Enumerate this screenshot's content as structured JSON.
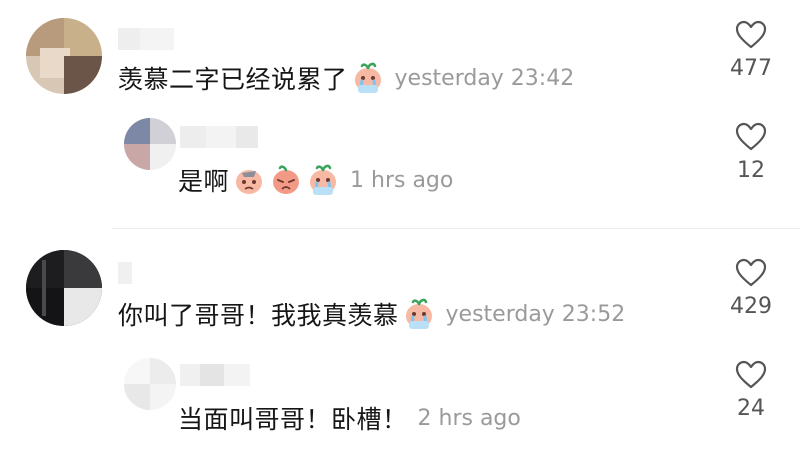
{
  "comments": [
    {
      "text": "羡慕二字已经说累了",
      "emoji": [
        "crying-face-icon"
      ],
      "time": "yesterday 23:42",
      "likes": "477",
      "reply": {
        "text": "是啊",
        "emoji": [
          "sad-face-icon",
          "upset-face-icon",
          "crying-face-icon"
        ],
        "time": "1 hrs ago",
        "likes": "12"
      }
    },
    {
      "text": "你叫了哥哥！我我真羡慕",
      "emoji": [
        "crying-face-icon"
      ],
      "time": "yesterday 23:52",
      "likes": "429",
      "reply": {
        "text": "当面叫哥哥！卧槽！",
        "time": "2 hrs ago",
        "likes": "24"
      }
    }
  ],
  "colors": {
    "emoji_face": "#f7b8a4",
    "emoji_leaf": "#3aa35c",
    "emoji_tears": "#7ec4f0",
    "meta_text": "#9a9a9a"
  }
}
